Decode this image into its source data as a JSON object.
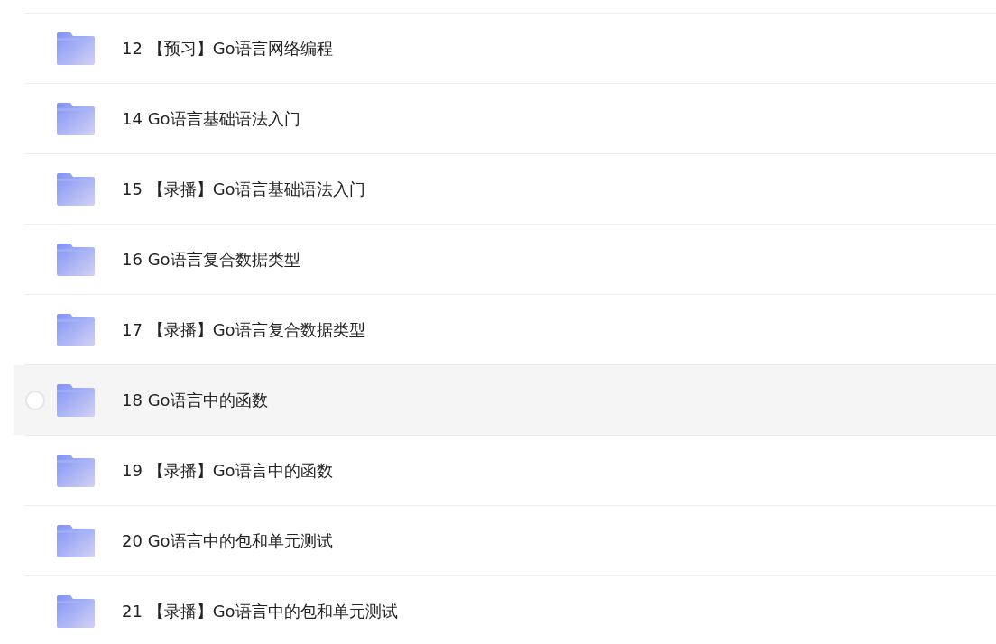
{
  "folders": [
    {
      "name": "12 【预习】Go语言网络编程",
      "highlighted": false
    },
    {
      "name": "14 Go语言基础语法入门",
      "highlighted": false
    },
    {
      "name": "15 【录播】Go语言基础语法入门",
      "highlighted": false
    },
    {
      "name": "16 Go语言复合数据类型",
      "highlighted": false
    },
    {
      "name": "17 【录播】Go语言复合数据类型",
      "highlighted": false
    },
    {
      "name": "18 Go语言中的函数",
      "highlighted": true
    },
    {
      "name": "19 【录播】Go语言中的函数",
      "highlighted": false
    },
    {
      "name": "20 Go语言中的包和单元测试",
      "highlighted": false
    },
    {
      "name": "21 【录播】Go语言中的包和单元测试",
      "highlighted": false
    }
  ]
}
